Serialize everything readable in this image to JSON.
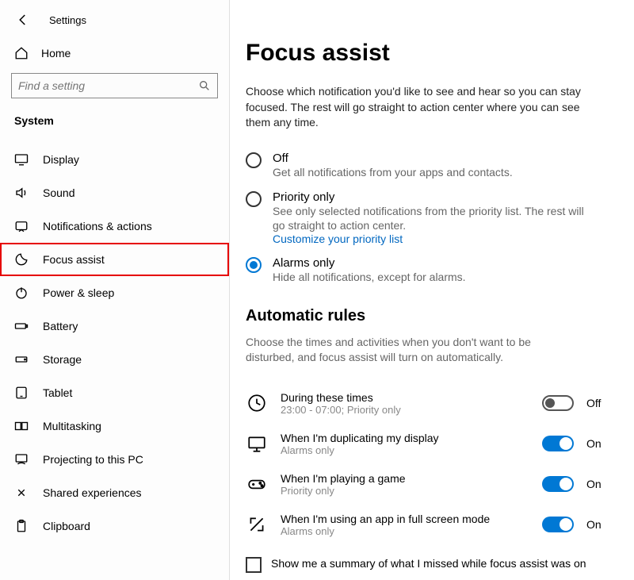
{
  "header": {
    "title": "Settings"
  },
  "home": {
    "label": "Home"
  },
  "search": {
    "placeholder": "Find a setting"
  },
  "section": "System",
  "nav": [
    {
      "label": "Display"
    },
    {
      "label": "Sound"
    },
    {
      "label": "Notifications & actions"
    },
    {
      "label": "Focus assist"
    },
    {
      "label": "Power & sleep"
    },
    {
      "label": "Battery"
    },
    {
      "label": "Storage"
    },
    {
      "label": "Tablet"
    },
    {
      "label": "Multitasking"
    },
    {
      "label": "Projecting to this PC"
    },
    {
      "label": "Shared experiences"
    },
    {
      "label": "Clipboard"
    }
  ],
  "page": {
    "title": "Focus assist",
    "intro": "Choose which notification you'd like to see and hear so you can stay focused. The rest will go straight to action center where you can see them any time.",
    "radios": {
      "off": {
        "label": "Off",
        "sub": "Get all notifications from your apps and contacts."
      },
      "priority": {
        "label": "Priority only",
        "sub": "See only selected notifications from the priority list. The rest will go straight to action center.",
        "link": "Customize your priority list"
      },
      "alarms": {
        "label": "Alarms only",
        "sub": "Hide all notifications, except for alarms."
      }
    },
    "rules_heading": "Automatic rules",
    "rules_desc": "Choose the times and activities when you don't want to be disturbed, and focus assist will turn on automatically.",
    "rules": [
      {
        "title": "During these times",
        "sub": "23:00 - 07:00; Priority only",
        "state": "Off",
        "on": false
      },
      {
        "title": "When I'm duplicating my display",
        "sub": "Alarms only",
        "state": "On",
        "on": true
      },
      {
        "title": "When I'm playing a game",
        "sub": "Priority only",
        "state": "On",
        "on": true
      },
      {
        "title": "When I'm using an app in full screen mode",
        "sub": "Alarms only",
        "state": "On",
        "on": true
      }
    ],
    "summary_checkbox": "Show me a summary of what I missed while focus assist was on"
  }
}
